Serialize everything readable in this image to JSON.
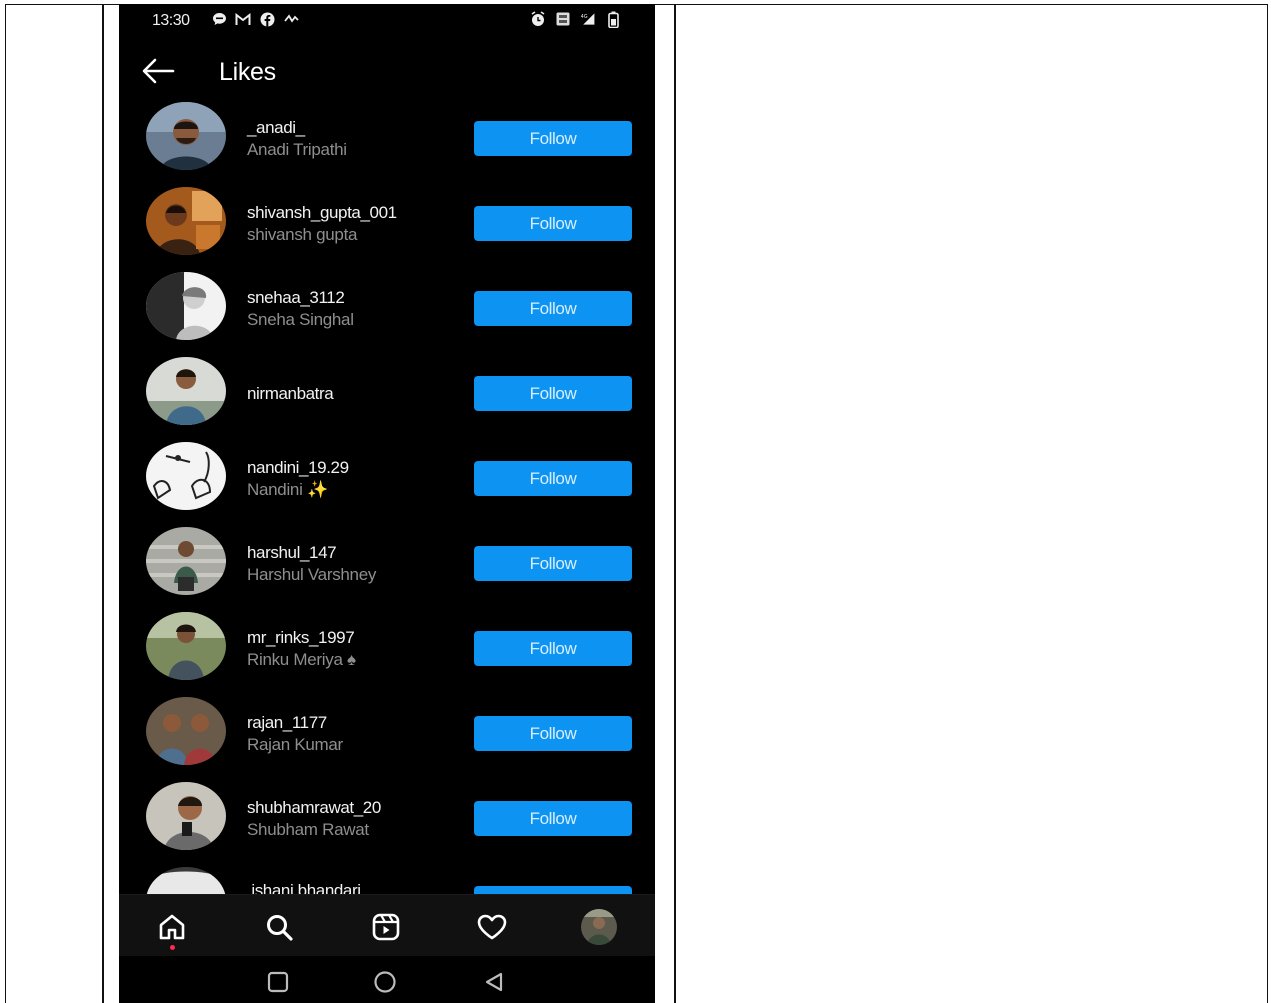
{
  "status_bar": {
    "time": "13:30",
    "left_icons": [
      "chat-bubble-icon",
      "gmail-icon",
      "facebook-icon",
      "activity-icon"
    ],
    "right_icons": [
      "alarm-icon",
      "sim-icon",
      "signal-icon",
      "battery-icon"
    ]
  },
  "header": {
    "back_icon": "arrow-left-icon",
    "title": "Likes"
  },
  "likes": [
    {
      "username": "_anadi_",
      "full_name": "Anadi Tripathi",
      "button": "Follow"
    },
    {
      "username": "shivansh_gupta_001",
      "full_name": "shivansh gupta",
      "button": "Follow"
    },
    {
      "username": "snehaa_3112",
      "full_name": "Sneha Singhal",
      "button": "Follow"
    },
    {
      "username": "nirmanbatra",
      "full_name": "",
      "button": "Follow"
    },
    {
      "username": "nandini_19.29",
      "full_name": "Nandini ✨",
      "button": "Follow"
    },
    {
      "username": "harshul_147",
      "full_name": "Harshul Varshney",
      "button": "Follow"
    },
    {
      "username": "mr_rinks_1997",
      "full_name": "Rinku Meriya ♠",
      "button": "Follow"
    },
    {
      "username": "rajan_1177",
      "full_name": "Rajan Kumar",
      "button": "Follow"
    },
    {
      "username": "shubhamrawat_20",
      "full_name": "Shubham Rawat",
      "button": "Follow"
    },
    {
      "username": ".ishani.bhandari.",
      "full_name": "",
      "button": "Follow"
    }
  ],
  "bottom_nav": [
    "home-icon",
    "search-icon",
    "reels-icon",
    "heart-icon",
    "profile-avatar"
  ],
  "system_nav": [
    "recents-square-icon",
    "home-circle-icon",
    "back-triangle-icon"
  ],
  "colors": {
    "background": "#000000",
    "follow_button": "#0d93f2",
    "secondary_text": "#8e8e8e",
    "notification_dot": "#ff2a55"
  }
}
